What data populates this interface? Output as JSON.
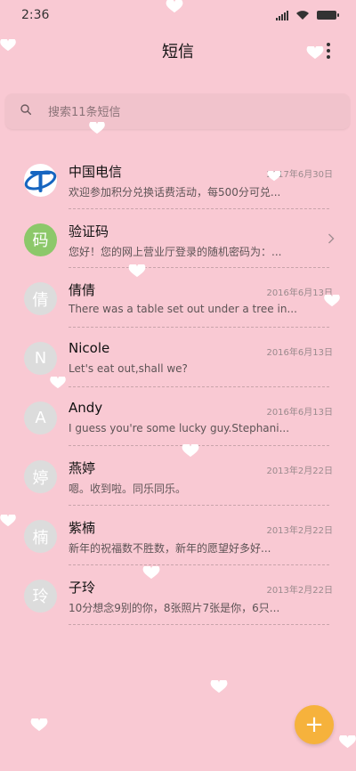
{
  "status_bar": {
    "time": "2:36"
  },
  "header": {
    "title": "短信"
  },
  "search": {
    "placeholder": "搜索11条短信"
  },
  "conversations": [
    {
      "name": "中国电信",
      "date": "2017年6月30日",
      "preview": "欢迎参加积分兑换话费活动，每500分可兑...",
      "avatar": "",
      "avatar_type": "telecom-logo"
    },
    {
      "name": "验证码",
      "date": "",
      "preview": "您好！您的网上营业厅登录的随机密码为：...",
      "avatar": "码",
      "avatar_type": "green"
    },
    {
      "name": "倩倩",
      "date": "2016年6月13日",
      "preview": "There was a table set out under a tree in...",
      "avatar": "倩",
      "avatar_type": "gray"
    },
    {
      "name": "Nicole",
      "date": "2016年6月13日",
      "preview": "Let's eat out,shall we?",
      "avatar": "N",
      "avatar_type": "gray"
    },
    {
      "name": "Andy",
      "date": "2016年6月13日",
      "preview": "I guess you're some lucky guy.Stephani...",
      "avatar": "A",
      "avatar_type": "gray"
    },
    {
      "name": "燕婷",
      "date": "2013年2月22日",
      "preview": "嗯。收到啦。同乐同乐。",
      "avatar": "婷",
      "avatar_type": "gray"
    },
    {
      "name": "紫楠",
      "date": "2013年2月22日",
      "preview": "新年的祝福数不胜数，新年的愿望好多好...",
      "avatar": "楠",
      "avatar_type": "gray"
    },
    {
      "name": "子玲",
      "date": "2013年2月22日",
      "preview": "10分想念9别的你，8张照片7张是你，6只...",
      "avatar": "玲",
      "avatar_type": "gray"
    }
  ],
  "fab": {
    "label": "+"
  },
  "colors": {
    "background": "#f9c9d3",
    "fab": "#f6b23c",
    "verify_avatar": "#8cc86a"
  },
  "icons": [
    "signal-icon",
    "wifi-icon",
    "battery-icon",
    "more-vert-icon",
    "search-icon",
    "chevron-right-icon",
    "heart-icon",
    "plus-icon",
    "china-telecom-logo"
  ]
}
